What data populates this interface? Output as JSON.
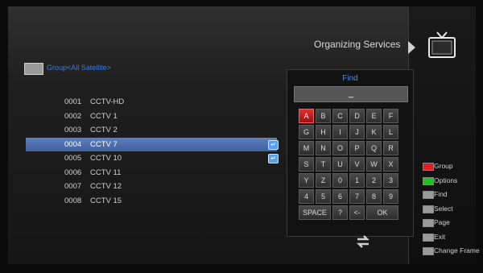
{
  "header": {
    "title": "Organizing Services",
    "group_label": "Group<All Satellite>"
  },
  "channels": [
    {
      "num": "0001",
      "name": "CCTV-HD",
      "selected": false,
      "has_swap": false
    },
    {
      "num": "0002",
      "name": "CCTV 1",
      "selected": false,
      "has_swap": false
    },
    {
      "num": "0003",
      "name": "CCTV 2",
      "selected": false,
      "has_swap": false
    },
    {
      "num": "0004",
      "name": "CCTV 7",
      "selected": true,
      "has_swap": true
    },
    {
      "num": "0005",
      "name": "CCTV 10",
      "selected": false,
      "has_swap": true
    },
    {
      "num": "0006",
      "name": "CCTV 11",
      "selected": false,
      "has_swap": false
    },
    {
      "num": "0007",
      "name": "CCTV 12",
      "selected": false,
      "has_swap": false
    },
    {
      "num": "0008",
      "name": "CCTV 15",
      "selected": false,
      "has_swap": false
    }
  ],
  "find": {
    "title": "Find",
    "input_value": "_",
    "rows": [
      [
        "A",
        "B",
        "C",
        "D",
        "E",
        "F"
      ],
      [
        "G",
        "H",
        "I",
        "J",
        "K",
        "L"
      ],
      [
        "M",
        "N",
        "O",
        "P",
        "Q",
        "R"
      ],
      [
        "S",
        "T",
        "U",
        "V",
        "W",
        "X"
      ],
      [
        "Y",
        "Z",
        "0",
        "1",
        "2",
        "3"
      ],
      [
        "4",
        "5",
        "6",
        "7",
        "8",
        "9"
      ]
    ],
    "bottom_keys": [
      "SPACE",
      "?",
      "<-",
      "OK"
    ],
    "active_key": "A"
  },
  "legend": [
    {
      "label": "Group",
      "icon": "red-key-icon",
      "color": "#e02020"
    },
    {
      "label": "Options",
      "icon": "green-key-icon",
      "color": "#20c020"
    },
    {
      "label": "Find",
      "icon": "find-key-icon",
      "color": "#9a9a9a"
    },
    {
      "label": "Select",
      "icon": "select-key-icon",
      "color": "#9a9a9a"
    },
    {
      "label": "Page",
      "icon": "page-key-icon",
      "color": "#9a9a9a"
    },
    {
      "label": "Exit",
      "icon": "exit-key-icon",
      "color": "#9a9a9a"
    },
    {
      "label": "Change Frame",
      "icon": "change-frame-key-icon",
      "color": "#9a9a9a"
    }
  ]
}
